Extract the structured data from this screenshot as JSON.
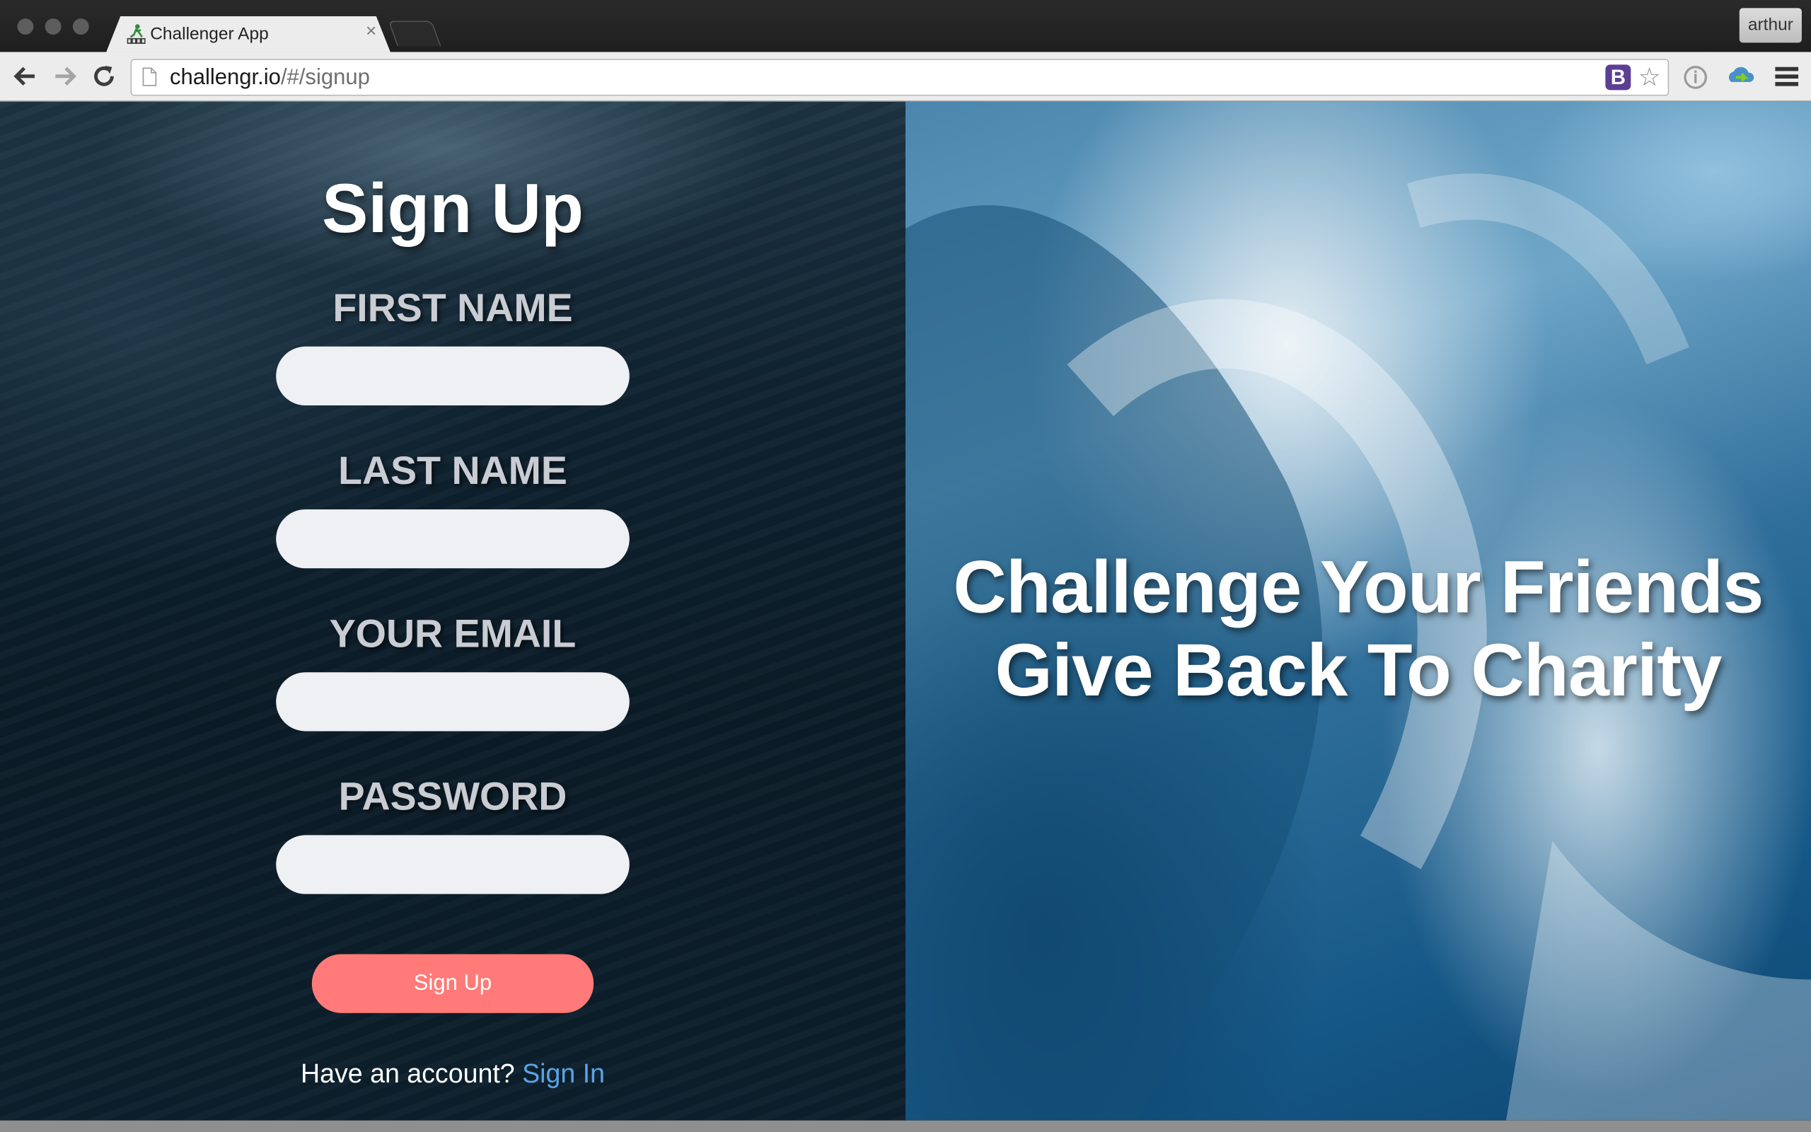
{
  "browser": {
    "tab_title": "Challenger App",
    "tab_close": "×",
    "profile_name": "arthur",
    "url_host": "challengr.io",
    "url_path": "/#/signup",
    "extension_label": "B",
    "star_glyph": "☆"
  },
  "form": {
    "title": "Sign Up",
    "fields": [
      {
        "label": "FIRST NAME",
        "value": ""
      },
      {
        "label": "LAST NAME",
        "value": ""
      },
      {
        "label": "YOUR EMAIL",
        "value": ""
      },
      {
        "label": "PASSWORD",
        "value": ""
      }
    ],
    "submit_label": "Sign Up",
    "signin_prompt": "Have an account?",
    "signin_link": "Sign In"
  },
  "hero": {
    "line1": "Challenge Your Friends",
    "line2": "Give Back To Charity"
  },
  "colors": {
    "submit_button": "#ff7a78",
    "signin_link": "#5aa4e6",
    "input_background": "#eff0f3"
  }
}
